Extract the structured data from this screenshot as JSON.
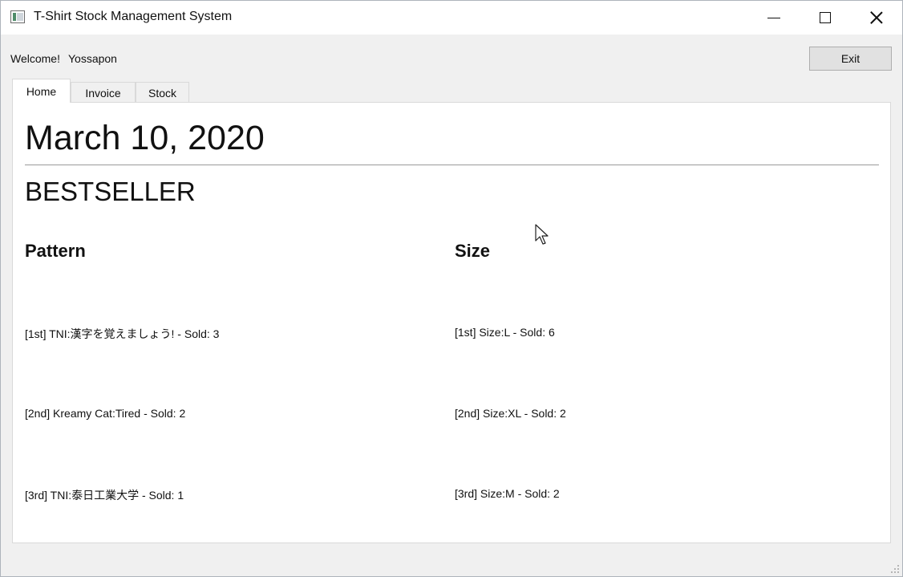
{
  "window": {
    "title": "T-Shirt Stock Management System"
  },
  "header": {
    "welcome_label": "Welcome!",
    "user_name": "Yossapon",
    "exit_label": "Exit"
  },
  "tabs": [
    {
      "label": "Home",
      "active": true
    },
    {
      "label": "Invoice",
      "active": false
    },
    {
      "label": "Stock",
      "active": false
    }
  ],
  "home": {
    "date": "March 10, 2020",
    "section_title": "BESTSELLER",
    "pattern_heading": "Pattern",
    "size_heading": "Size",
    "patterns": [
      "[1st] TNI:漢字を覚えましょう! - Sold: 3",
      "[2nd] Kreamy Cat:Tired - Sold: 2",
      "[3rd] TNI:泰日工業大学 - Sold: 1"
    ],
    "sizes": [
      "[1st] Size:L - Sold: 6",
      "[2nd] Size:XL - Sold: 2",
      "[3rd] Size:M - Sold: 2"
    ]
  },
  "colors": {
    "window_bg": "#f0f0f0",
    "panel_bg": "#ffffff",
    "button_bg": "#e1e1e1"
  }
}
